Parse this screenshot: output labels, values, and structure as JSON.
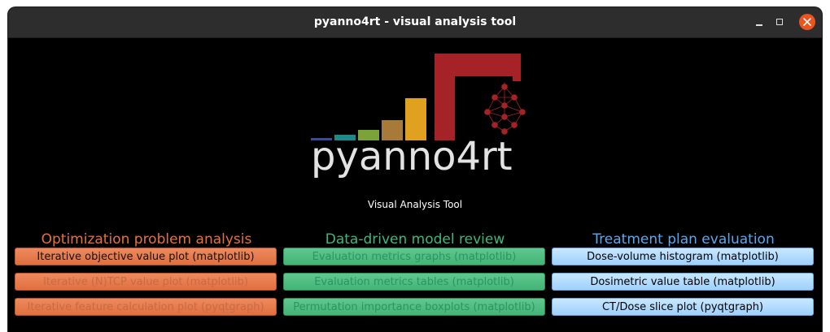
{
  "window": {
    "title": "pyanno4rt - visual analysis tool"
  },
  "logo": {
    "text": "pyanno4rt",
    "subtitle": "Visual Analysis Tool",
    "bar_colors": [
      "#3a4b9c",
      "#1e8b8a",
      "#7aa33a",
      "#a87a3a",
      "#e0a020",
      "#a52226"
    ]
  },
  "sections": [
    {
      "heading": "Optimization problem analysis",
      "color": "#e8703c",
      "buttons": [
        {
          "label": "Iterative objective value plot (matplotlib)",
          "enabled": true
        },
        {
          "label": "Iterative (N)TCP value plot (matplotlib)",
          "enabled": false
        },
        {
          "label": "Iterative feature calculation plot (pyqtgraph)",
          "enabled": false
        }
      ]
    },
    {
      "heading": "Data-driven model review",
      "color": "#3fb77a",
      "buttons": [
        {
          "label": "Evaluation metrics graphs (matplotlib)",
          "enabled": false
        },
        {
          "label": "Evaluation metrics tables (matplotlib)",
          "enabled": false
        },
        {
          "label": "Permutation importance boxplots (matplotlib)",
          "enabled": false
        }
      ]
    },
    {
      "heading": "Treatment plan evaluation",
      "color": "#5aa8f0",
      "buttons": [
        {
          "label": "Dose-volume histogram (matplotlib)",
          "enabled": true
        },
        {
          "label": "Dosimetric value table (matplotlib)",
          "enabled": true
        },
        {
          "label": "CT/Dose slice plot (pyqtgraph)",
          "enabled": true
        }
      ]
    }
  ]
}
